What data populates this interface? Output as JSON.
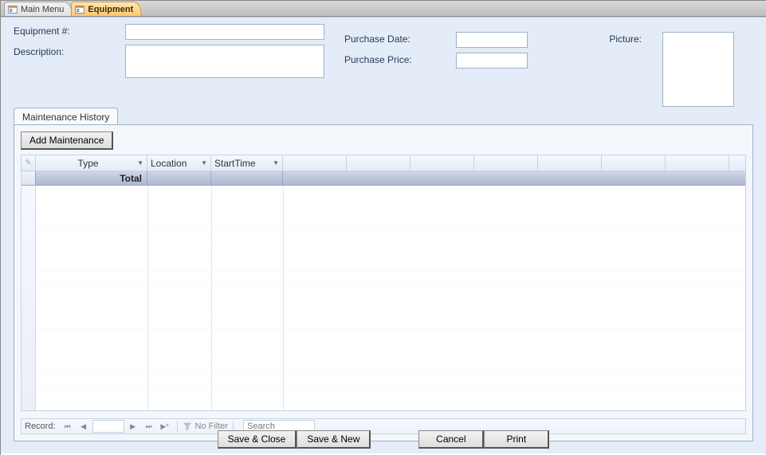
{
  "tabs": {
    "main_menu": "Main Menu",
    "equipment": "Equipment"
  },
  "fields": {
    "equipment_number_label": "Equipment #:",
    "equipment_number_value": "",
    "description_label": "Description:",
    "description_value": "",
    "purchase_date_label": "Purchase Date:",
    "purchase_date_value": "",
    "purchase_price_label": "Purchase Price:",
    "purchase_price_value": "",
    "picture_label": "Picture:"
  },
  "inner_tab": {
    "label": "Maintenance History",
    "add_button": "Add Maintenance",
    "columns": {
      "type": "Type",
      "location": "Location",
      "start_time": "StartTime"
    },
    "totals_label": "Total",
    "recordnav": {
      "label": "Record:",
      "filter": "No Filter",
      "search_placeholder": "Search"
    }
  },
  "buttons": {
    "save_close": "Save & Close",
    "save_new": "Save & New",
    "cancel": "Cancel",
    "print": "Print"
  }
}
